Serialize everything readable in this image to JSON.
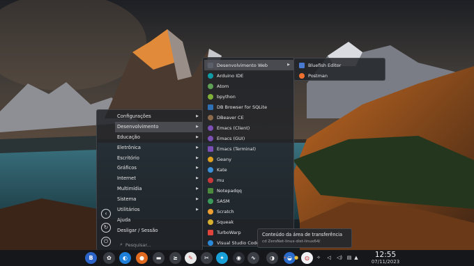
{
  "main_menu": {
    "categories": [
      {
        "label": "Configurações",
        "active": false
      },
      {
        "label": "Desenvolvimento",
        "active": true
      },
      {
        "label": "Educação",
        "active": false
      },
      {
        "label": "Eletrônica",
        "active": false
      },
      {
        "label": "Escritório",
        "active": false
      },
      {
        "label": "Gráficos",
        "active": false
      },
      {
        "label": "Internet",
        "active": false
      },
      {
        "label": "Multimídia",
        "active": false
      },
      {
        "label": "Sistema",
        "active": false
      },
      {
        "label": "Utilitários",
        "active": false
      },
      {
        "label": "Ajuda",
        "active": false
      },
      {
        "label": "Desligar / Sessão",
        "active": false
      }
    ],
    "arrow_glyph": "▶",
    "search_placeholder": "Pesquisar...",
    "side_icons": [
      "back-icon",
      "refresh-icon",
      "power-icon"
    ]
  },
  "dev_menu": {
    "items": [
      {
        "label": "Desenvolvimento Web",
        "icon": "web-dev-icon",
        "color": "#5b5f69",
        "submenu": true,
        "active": true
      },
      {
        "label": "Arduino IDE",
        "icon": "arduino-icon",
        "color": "#0f9ba6"
      },
      {
        "label": "Atom",
        "icon": "atom-icon",
        "color": "#5ea055"
      },
      {
        "label": "bpython",
        "icon": "bpython-icon",
        "color": "#7fb03a"
      },
      {
        "label": "DB Browser for SQLite",
        "icon": "sqlite-icon",
        "color": "#2f6fb3"
      },
      {
        "label": "DBeaver CE",
        "icon": "dbeaver-icon",
        "color": "#8a6a4a"
      },
      {
        "label": "Emacs (Client)",
        "icon": "emacs-icon",
        "color": "#7c4fb5"
      },
      {
        "label": "Emacs (GUI)",
        "icon": "emacs-icon",
        "color": "#7c4fb5"
      },
      {
        "label": "Emacs (Terminal)",
        "icon": "emacs-icon",
        "color": "#7c4fb5"
      },
      {
        "label": "Geany",
        "icon": "geany-icon",
        "color": "#e0a020"
      },
      {
        "label": "Kate",
        "icon": "kate-icon",
        "color": "#3a8fd8"
      },
      {
        "label": "mu",
        "icon": "mu-icon",
        "color": "#c83a3a"
      },
      {
        "label": "Notepadqq",
        "icon": "notepadqq-icon",
        "color": "#4b8a3c"
      },
      {
        "label": "SASM",
        "icon": "sasm-icon",
        "color": "#3a9a5a"
      },
      {
        "label": "Scratch",
        "icon": "scratch-icon",
        "color": "#f0a030"
      },
      {
        "label": "Squeak",
        "icon": "squeak-icon",
        "color": "#d8b030"
      },
      {
        "label": "TurboWarp",
        "icon": "turbowarp-icon",
        "color": "#e0443c"
      },
      {
        "label": "Visual Studio Code",
        "icon": "vscode-icon",
        "color": "#2a8ad8"
      }
    ]
  },
  "web_menu": {
    "items": [
      {
        "label": "Bluefish Editor",
        "icon": "bluefish-icon",
        "color": "#4a7ad0"
      },
      {
        "label": "Postman",
        "icon": "postman-icon",
        "color": "#f07030"
      }
    ]
  },
  "tooltip": {
    "title": "Conteúdo da área de transferência",
    "detail": "cd ZeroNet-linux-dist-linux64/"
  },
  "taskbar": {
    "apps": [
      {
        "name": "app-menu-icon",
        "glyph": "B",
        "color": "#2b63c7"
      },
      {
        "name": "settings-icon",
        "glyph": "✿",
        "color": "#3a3c44"
      },
      {
        "name": "discover-icon",
        "glyph": "◐",
        "color": "#1e7fd8"
      },
      {
        "name": "firefox-icon",
        "glyph": "●",
        "color": "#e06a20"
      },
      {
        "name": "files-icon",
        "glyph": "▬",
        "color": "#3b3d45"
      },
      {
        "name": "terminal-icon",
        "glyph": "≥",
        "color": "#3b3d45"
      },
      {
        "name": "inkscape-icon",
        "glyph": "✎",
        "color": "#e8e8e8"
      },
      {
        "name": "kdenlive-icon",
        "glyph": "✂",
        "color": "#3b3d45"
      },
      {
        "name": "kstars-icon",
        "glyph": "✦",
        "color": "#1aa0d8"
      },
      {
        "name": "blender-icon",
        "glyph": "◉",
        "color": "#2a2c34"
      },
      {
        "name": "network-icon",
        "glyph": "∿",
        "color": "#3c3e46"
      },
      {
        "name": "toggle-icon",
        "glyph": "◑",
        "color": "#3c3e46"
      },
      {
        "name": "shield-icon",
        "glyph": "◒",
        "color": "#2a6ac8"
      },
      {
        "name": "clipboard-icon",
        "glyph": "◍",
        "color": "#f2f2f4"
      }
    ],
    "tray": [
      {
        "name": "crosshair-icon",
        "glyph": "⌖",
        "color": "#f07020"
      },
      {
        "name": "moon-icon",
        "glyph": "●",
        "color": "#e8c040"
      },
      {
        "name": "folder-icon",
        "glyph": "▭",
        "color": "#e0e0e4"
      },
      {
        "name": "dropbox-icon",
        "glyph": "✧",
        "color": "#e0e0e4"
      },
      {
        "name": "audio-icon",
        "glyph": "◁",
        "color": "#e0e0e4"
      },
      {
        "name": "volume-icon",
        "glyph": "◁)",
        "color": "#e0e0e4"
      },
      {
        "name": "printer-icon",
        "glyph": "▤",
        "color": "#e0e0e4"
      },
      {
        "name": "expand-tray-icon",
        "glyph": "▲",
        "color": "#e0e0e4"
      }
    ],
    "clock_time": "12:55",
    "clock_date": "07/11/2023"
  }
}
